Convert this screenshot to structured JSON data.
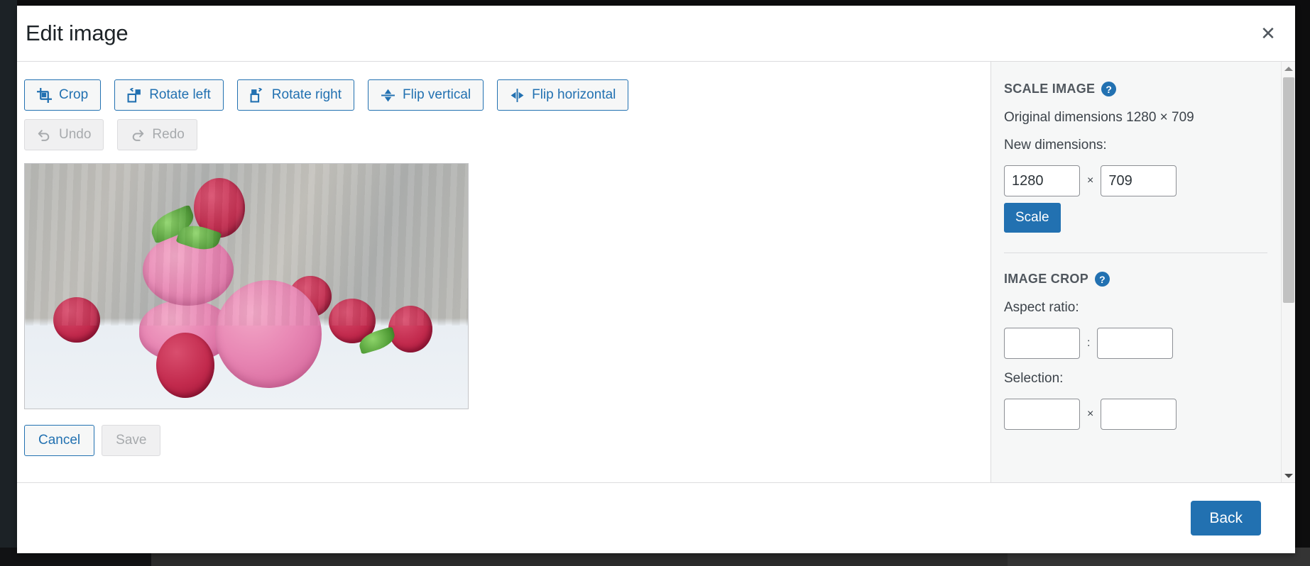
{
  "modal": {
    "title": "Edit image",
    "close_label": "✕"
  },
  "toolbar": {
    "primary": [
      {
        "label": "Crop",
        "icon": "crop-icon"
      },
      {
        "label": "Rotate left",
        "icon": "rotate-left-icon"
      },
      {
        "label": "Rotate right",
        "icon": "rotate-right-icon"
      },
      {
        "label": "Flip vertical",
        "icon": "flip-vertical-icon"
      },
      {
        "label": "Flip horizontal",
        "icon": "flip-horizontal-icon"
      }
    ],
    "history": [
      {
        "label": "Undo",
        "icon": "undo-icon",
        "disabled": true
      },
      {
        "label": "Redo",
        "icon": "redo-icon",
        "disabled": true
      }
    ]
  },
  "editor_actions": {
    "cancel_label": "Cancel",
    "save_label": "Save",
    "save_disabled": true
  },
  "image_preview": {
    "alt": "Pink macarons stacked with fresh raspberries and mint leaves on a white surface"
  },
  "settings": {
    "scale_image": {
      "heading": "SCALE IMAGE",
      "help_glyph": "?",
      "original_dimensions_label": "Original dimensions 1280 × 709",
      "new_dimensions_label": "New dimensions:",
      "width_value": "1280",
      "height_value": "709",
      "multiply_symbol": "×",
      "scale_button_label": "Scale"
    },
    "image_crop": {
      "heading": "IMAGE CROP",
      "help_glyph": "?",
      "aspect_ratio_label": "Aspect ratio:",
      "aspect_ratio_width": "",
      "aspect_ratio_height": "",
      "ratio_separator": ":",
      "selection_label": "Selection:",
      "selection_width": "",
      "selection_height": "",
      "multiply_symbol": "×"
    }
  },
  "footer": {
    "back_label": "Back"
  },
  "scrollbar": {
    "up_arrow": "▲",
    "down_arrow": "▼"
  },
  "colors": {
    "accent": "#2271b1",
    "text": "#1d2327",
    "muted": "#50575e",
    "panel_bg": "#f6f7f7",
    "border": "#dcdcde"
  }
}
